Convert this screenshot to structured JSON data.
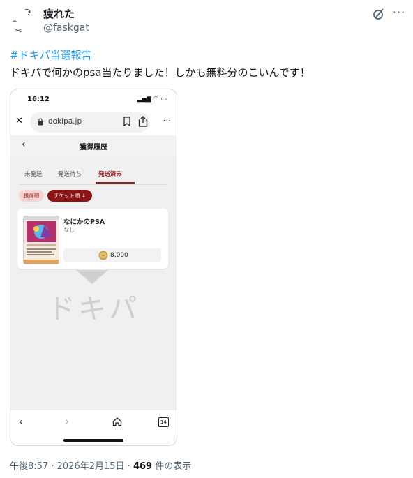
{
  "tweet": {
    "display_name": "疲れた",
    "handle": "@faskgat",
    "hashtag": "#ドキパ当選報告",
    "text": "ドキパで何かのpsa当たりました！しかも無料分のこいんです！",
    "time": "午後8:57",
    "sep1": "·",
    "date": "2026年2月15日",
    "sep2": "·",
    "views_count": "469",
    "views_label": "件の表示",
    "more_label": "···"
  },
  "screenshot": {
    "status_time": "16:12",
    "status_icons": "▂▄▆ ◠ ▭",
    "url": "dokipa.jp",
    "close_glyph": "✕",
    "dots_glyph": "···",
    "back_glyph": "‹",
    "page_title": "獲得履歴",
    "tabs": [
      "未発送",
      "発送待ち",
      "発送済み"
    ],
    "active_tab": "発送済み",
    "sort_primary": "獲得順",
    "sort_secondary": "チケット順 ↓",
    "item": {
      "name": "なにかのPSA",
      "sub": "なし",
      "price": "8,000"
    },
    "watermark": "ドキパ",
    "nav": {
      "back": "‹",
      "forward": "›",
      "tabs_count": "14"
    }
  },
  "colors": {
    "accent_red": "#8b1515",
    "link_blue": "#1d9bf0"
  }
}
